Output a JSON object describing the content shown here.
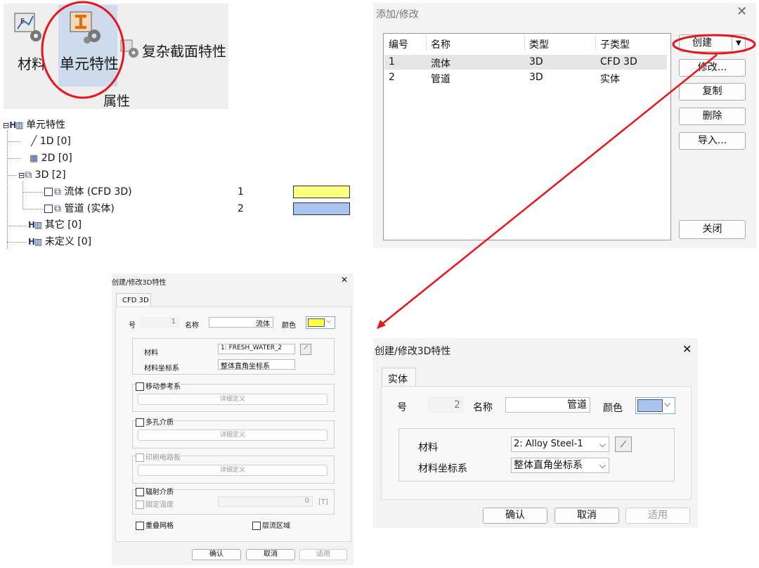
{
  "ribbon": {
    "materials_label": "材料",
    "element_props_label": "单元特性",
    "complex_section_label": "复杂截面特性",
    "group_label": "属性"
  },
  "tree": {
    "root": "单元特性",
    "items": [
      {
        "label": "1D [0]",
        "icon": "line-icon"
      },
      {
        "label": "2D [0]",
        "icon": "mesh-icon"
      },
      {
        "label": "3D [2]",
        "icon": "solid-icon"
      },
      {
        "label": "流体 (CFD 3D)",
        "id": "1",
        "color": "#ffff80"
      },
      {
        "label": "管道 (实体)",
        "id": "2",
        "color": "#a9c4f0"
      },
      {
        "label": "其它 [0]",
        "icon": "hd-icon"
      },
      {
        "label": "未定义 [0]",
        "icon": "hd-icon"
      }
    ]
  },
  "add_modify_dialog": {
    "title": "添加/修改",
    "columns": [
      "编号",
      "名称",
      "类型",
      "子类型"
    ],
    "rows": [
      [
        "1",
        "流体",
        "3D",
        "CFD 3D"
      ],
      [
        "2",
        "管道",
        "3D",
        "实体"
      ]
    ],
    "buttons": {
      "create": "创建",
      "modify": "修改...",
      "copy": "复制",
      "delete": "删除",
      "import": "导入...",
      "close": "关闭"
    }
  },
  "cfd_dialog": {
    "title": "创建/修改3D特性",
    "tab": "CFD 3D",
    "number_label": "号",
    "number_value": "1",
    "name_label": "名称",
    "name_value": "流体",
    "color_label": "颜色",
    "color_value": "#ffff44",
    "material_label": "材料",
    "material_value": "1: FRESH_WATER_2",
    "coord_label": "材料坐标系",
    "coord_value": "整体直角坐标系",
    "moving_ref": "移动参考系",
    "detail1": "详细定义",
    "porous": "多孔介质",
    "detail2": "详细定义",
    "pcb": "印刷电路板",
    "detail3": "详细定义",
    "radiation": "辐射介质",
    "fixed_temp": "固定温度",
    "temp_value": "0",
    "temp_unit": "[T]",
    "overlap_mesh": "重叠网格",
    "laminar": "层流区域",
    "ok": "确认",
    "cancel": "取消",
    "apply": "适用"
  },
  "solid_dialog": {
    "title": "创建/修改3D特性",
    "tab": "实体",
    "number_label": "号",
    "number_value": "2",
    "name_label": "名称",
    "name_value": "管道",
    "color_label": "颜色",
    "color_value": "#a9c4f0",
    "material_label": "材料",
    "material_value": "2: Alloy Steel-1",
    "coord_label": "材料坐标系",
    "coord_value": "整体直角坐标系",
    "ok": "确认",
    "cancel": "取消",
    "apply": "适用"
  },
  "colors": {
    "annotation_red": "#e8141b",
    "highlight_blue": "#cddbec",
    "selected_row": "#e6e6e6"
  }
}
